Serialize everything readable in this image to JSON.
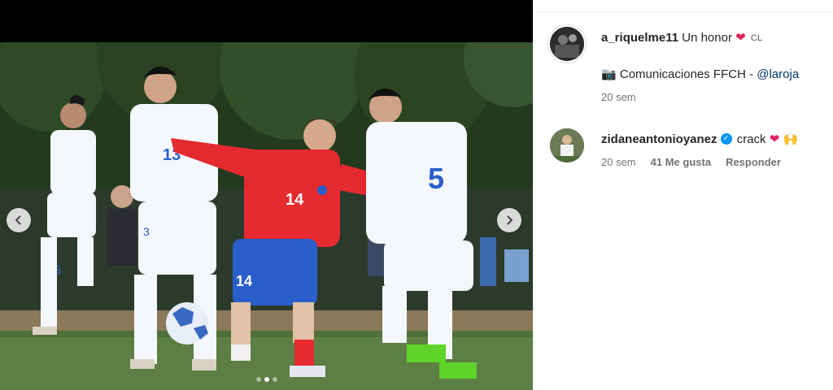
{
  "post": {
    "image_alt": "Jugadores de fútbol en un partido: Chile con camiseta roja número 14 frente a jugadores de camiseta blanca",
    "carousel": {
      "prev_label": "‹",
      "next_label": "›",
      "slide_count": 3,
      "active_index": 1
    }
  },
  "comments": [
    {
      "username": "a_riquelme11",
      "text": "Un honor",
      "emojis": [
        "❤",
        "CL"
      ],
      "line2_icon": "📷",
      "line2_text": "Comunicaciones FFCH - ",
      "mention": "@laroja",
      "time": "20 sem"
    },
    {
      "username": "zidaneantonioyanez",
      "verified": true,
      "text": "crack",
      "emojis": [
        "❤",
        "🙌"
      ],
      "time": "20 sem",
      "likes": "41 Me gusta",
      "reply_label": "Responder"
    }
  ],
  "colors": {
    "chile_red": "#e52a2f",
    "chile_blue": "#2a5fc9",
    "opponent_white": "#f4f7fb",
    "pitch_green": "#5d7f45"
  }
}
